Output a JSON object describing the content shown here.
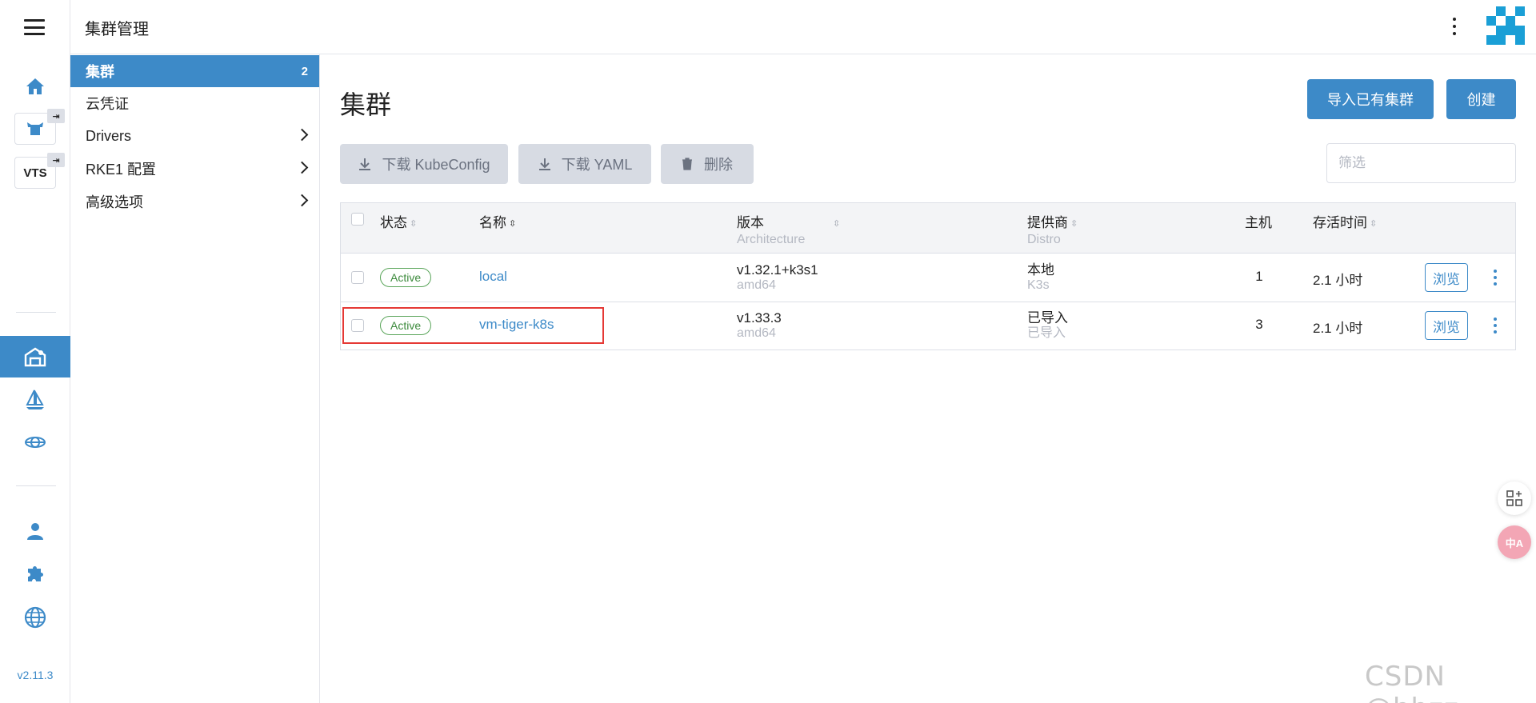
{
  "header": {
    "title": "集群管理"
  },
  "rail": {
    "box1_pin": "⇥",
    "box2_label": "VTS",
    "box2_pin": "⇥",
    "version": "v2.11.3"
  },
  "sidenav": {
    "items": [
      {
        "label": "集群",
        "count": "2"
      },
      {
        "label": "云凭证"
      },
      {
        "label": "Drivers"
      },
      {
        "label": "RKE1 配置"
      },
      {
        "label": "高级选项"
      }
    ]
  },
  "main": {
    "title": "集群",
    "import_button": "导入已有集群",
    "create_button": "创建",
    "download_kubeconfig": "下载 KubeConfig",
    "download_yaml": "下载 YAML",
    "delete": "删除",
    "filter_placeholder": "筛选"
  },
  "table": {
    "headers": {
      "state": "状态",
      "name": "名称",
      "version": "版本",
      "version_sub": "Architecture",
      "provider": "提供商",
      "provider_sub": "Distro",
      "hosts": "主机",
      "age": "存活时间"
    },
    "rows": [
      {
        "state": "Active",
        "name": "local",
        "version": "v1.32.1+k3s1",
        "arch": "amd64",
        "provider": "本地",
        "distro": "K3s",
        "hosts": "1",
        "age": "2.1 小时",
        "action": "浏览"
      },
      {
        "state": "Active",
        "name": "vm-tiger-k8s",
        "version": "v1.33.3",
        "arch": "amd64",
        "provider": "已导入",
        "distro": "已导入",
        "hosts": "3",
        "age": "2.1 小时",
        "action": "浏览"
      }
    ]
  },
  "icons": [
    "menu-icon",
    "home-icon",
    "cow-icon",
    "pin-icon",
    "cluster-icon",
    "sail-icon",
    "globe-wire-icon",
    "user-icon",
    "puzzle-icon",
    "globe-icon",
    "download-icon",
    "trash-icon",
    "more-icon",
    "apps-icon",
    "translate-icon"
  ],
  "colors": {
    "accent": "#3d8ac8",
    "active_green": "#5aa55a",
    "highlight_red": "#e53935",
    "logo": "#1a9fd6"
  },
  "watermark": "CSDN @hhzz",
  "float": {
    "translate_label": "中A"
  }
}
